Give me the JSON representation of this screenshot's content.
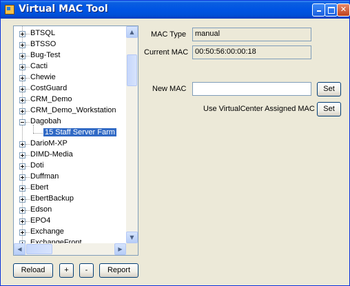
{
  "window": {
    "title": "Virtual MAC Tool"
  },
  "tree": {
    "items": [
      {
        "label": "BTSQL",
        "expander": "plus"
      },
      {
        "label": "BTSSO",
        "expander": "plus"
      },
      {
        "label": "Bug-Test",
        "expander": "plus"
      },
      {
        "label": "Cacti",
        "expander": "plus"
      },
      {
        "label": "Chewie",
        "expander": "plus"
      },
      {
        "label": "CostGuard",
        "expander": "plus"
      },
      {
        "label": "CRM_Demo",
        "expander": "plus"
      },
      {
        "label": "CRM_Demo_Workstation",
        "expander": "plus"
      },
      {
        "label": "Dagobah",
        "expander": "minus"
      },
      {
        "label": "15 Staff Server Farm",
        "expander": "none",
        "selected": true
      },
      {
        "label": "DarioM-XP",
        "expander": "plus"
      },
      {
        "label": "DIMD-Media",
        "expander": "plus"
      },
      {
        "label": "Doti",
        "expander": "plus"
      },
      {
        "label": "Duffman",
        "expander": "plus"
      },
      {
        "label": "Ebert",
        "expander": "plus"
      },
      {
        "label": "EbertBackup",
        "expander": "plus"
      },
      {
        "label": "Edson",
        "expander": "plus"
      },
      {
        "label": "EPO4",
        "expander": "plus"
      },
      {
        "label": "Exchange",
        "expander": "plus"
      },
      {
        "label": "ExchangeFront",
        "expander": "plus"
      }
    ]
  },
  "buttons": {
    "reload": "Reload",
    "plus": "+",
    "minus": "-",
    "report": "Report"
  },
  "details": {
    "mac_type_label": "MAC Type",
    "mac_type_value": "manual",
    "current_mac_label": "Current MAC",
    "current_mac_value": "00:50:56:00:00:18",
    "new_mac_label": "New MAC",
    "new_mac_value": "",
    "set_label": "Set",
    "vc_label": "Use VirtualCenter Assigned MAC",
    "vc_set_label": "Set"
  },
  "icons": {
    "app": "app-icon",
    "minimize": "minimize-icon",
    "maximize": "maximize-icon",
    "close": "close-icon"
  }
}
